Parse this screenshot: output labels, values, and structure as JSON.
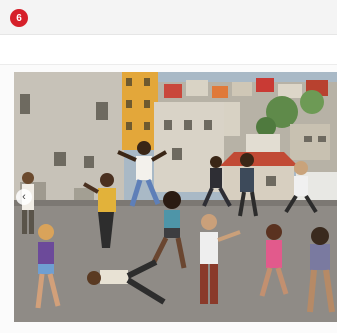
{
  "header": {
    "badge_count": "6"
  },
  "artwork": {
    "colors": {
      "sky": "#a9b9c6",
      "street": "#8f8b86",
      "wall": "#c7c2b8",
      "yellow_building": "#e3a73a"
    }
  }
}
